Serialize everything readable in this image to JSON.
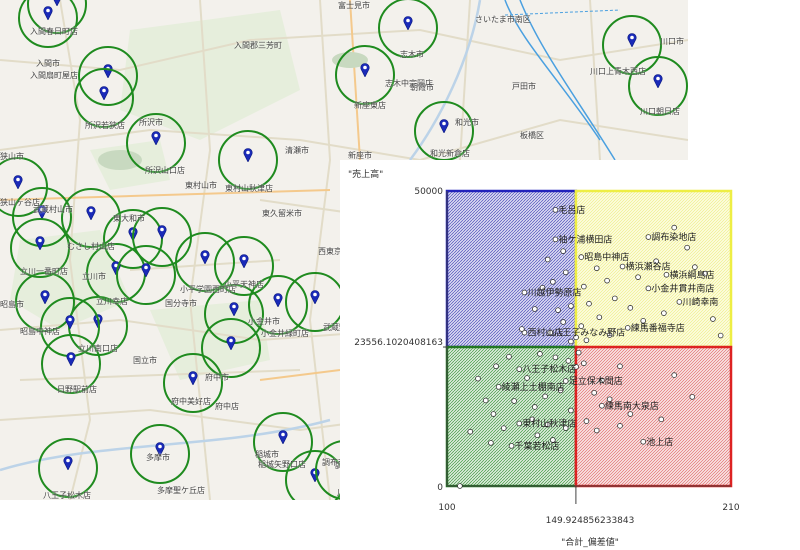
{
  "map": {
    "cities": [
      {
        "name": "入間春日町店"
      },
      {
        "name": "入間市"
      },
      {
        "name": "入間扇町屋店"
      },
      {
        "name": "入間郡三芳町"
      },
      {
        "name": "富士見市"
      },
      {
        "name": "さいたま市南区"
      },
      {
        "name": "志木市"
      },
      {
        "name": "志木中宗岡店"
      },
      {
        "name": "新座東店"
      },
      {
        "name": "朝霞市"
      },
      {
        "name": "戸田市"
      },
      {
        "name": "和光市"
      },
      {
        "name": "和光新倉店"
      },
      {
        "name": "板橋区"
      },
      {
        "name": "川口市"
      },
      {
        "name": "川口上青木西店"
      },
      {
        "name": "川口朝日店"
      },
      {
        "name": "所沢若狭店"
      },
      {
        "name": "所沢市"
      },
      {
        "name": "所沢山口店"
      },
      {
        "name": "清瀬市"
      },
      {
        "name": "新座市"
      },
      {
        "name": "東村山秋津店"
      },
      {
        "name": "東村山市"
      },
      {
        "name": "東久留米市"
      },
      {
        "name": "西東京市"
      },
      {
        "name": "狭山市"
      },
      {
        "name": "武蔵村山市"
      },
      {
        "name": "東大和市"
      },
      {
        "name": "むさし村山店"
      },
      {
        "name": "立川一番町店"
      },
      {
        "name": "立川市"
      },
      {
        "name": "立川幸店"
      },
      {
        "name": "昭島市"
      },
      {
        "name": "昭島中神店"
      },
      {
        "name": "立川南口店"
      },
      {
        "name": "小平学園西町店"
      },
      {
        "name": "小平天神店"
      },
      {
        "name": "国分寺市"
      },
      {
        "name": "小金井市"
      },
      {
        "name": "小金井緑町店"
      },
      {
        "name": "武蔵野"
      },
      {
        "name": "国立市"
      },
      {
        "name": "府中市"
      },
      {
        "name": "府中店"
      },
      {
        "name": "府中美好店"
      },
      {
        "name": "日野駅前店"
      },
      {
        "name": "多摩市"
      },
      {
        "name": "多摩聖ケ丘店"
      },
      {
        "name": "稲城市"
      },
      {
        "name": "稲城矢野口店"
      },
      {
        "name": "調布市"
      },
      {
        "name": "調布染"
      },
      {
        "name": "川崎市多"
      },
      {
        "name": "八王子松木店"
      },
      {
        "name": "狭山ヶ谷店"
      }
    ]
  },
  "chart_data": {
    "type": "scatter",
    "ylabel": "\"売上高\"",
    "xlabel": "\"合計_偏差値\"",
    "xlim": [
      100,
      210
    ],
    "ylim": [
      0,
      50000
    ],
    "x_ticks": [
      "100",
      "210"
    ],
    "y_ticks": [
      "0",
      "50000"
    ],
    "x_divider": 149.924856233843,
    "y_divider": 23556.1020408163,
    "x_divider_label": "149.924856233843",
    "y_divider_label": "23556.1020408163",
    "quadrant_colors": {
      "top_left": "#2222bb",
      "top_right": "#eeee44",
      "bottom_left": "#227722",
      "bottom_right": "#dd2222"
    },
    "points": [
      {
        "x": 142,
        "y": 46800,
        "label": "毛呂店"
      },
      {
        "x": 142,
        "y": 41800,
        "label": "袖ケ浦横田店"
      },
      {
        "x": 152,
        "y": 38800,
        "label": "昭島中神店"
      },
      {
        "x": 178,
        "y": 42200,
        "label": "調布染地店"
      },
      {
        "x": 168,
        "y": 37200,
        "label": "横浜瀬谷店"
      },
      {
        "x": 185,
        "y": 35800,
        "label": "横浜綱島店"
      },
      {
        "x": 178,
        "y": 33500,
        "label": "小金井貫井南店"
      },
      {
        "x": 190,
        "y": 31200,
        "label": "川崎幸南"
      },
      {
        "x": 130,
        "y": 32800,
        "label": "川越伊勢原店"
      },
      {
        "x": 130,
        "y": 26000,
        "label": "西村山店"
      },
      {
        "x": 140,
        "y": 26000,
        "label": "八王子みなみ野店"
      },
      {
        "x": 170,
        "y": 26800,
        "label": "練馬番福寺店"
      },
      {
        "x": 128,
        "y": 19800,
        "label": "八王子松木店"
      },
      {
        "x": 146,
        "y": 17800,
        "label": "足立保木間店"
      },
      {
        "x": 120,
        "y": 16800,
        "label": "綾瀬上土棚南店"
      },
      {
        "x": 160,
        "y": 13600,
        "label": "練馬南大泉店"
      },
      {
        "x": 128,
        "y": 10600,
        "label": "東村山秋津店"
      },
      {
        "x": 125,
        "y": 6800,
        "label": "千葉若松店"
      },
      {
        "x": 176,
        "y": 7500,
        "label": "池上店"
      },
      {
        "x": 112,
        "y": 18200
      },
      {
        "x": 115,
        "y": 14500
      },
      {
        "x": 118,
        "y": 12200
      },
      {
        "x": 109,
        "y": 9200
      },
      {
        "x": 122,
        "y": 9800
      },
      {
        "x": 134,
        "y": 13400
      },
      {
        "x": 138,
        "y": 15200
      },
      {
        "x": 142,
        "y": 21800
      },
      {
        "x": 147,
        "y": 21200
      },
      {
        "x": 150,
        "y": 20200
      },
      {
        "x": 136,
        "y": 22400
      },
      {
        "x": 124,
        "y": 21900
      },
      {
        "x": 119,
        "y": 20300
      },
      {
        "x": 131,
        "y": 18300
      },
      {
        "x": 144,
        "y": 16200
      },
      {
        "x": 148,
        "y": 12800
      },
      {
        "x": 146,
        "y": 9800
      },
      {
        "x": 141,
        "y": 7800
      },
      {
        "x": 135,
        "y": 8600
      },
      {
        "x": 117,
        "y": 7300
      },
      {
        "x": 105,
        "y": 0
      },
      {
        "x": 126,
        "y": 14400
      },
      {
        "x": 133,
        "y": 11300
      },
      {
        "x": 139,
        "y": 10400
      },
      {
        "x": 151,
        "y": 22600
      },
      {
        "x": 148,
        "y": 24500
      },
      {
        "x": 150,
        "y": 25200
      },
      {
        "x": 152,
        "y": 27100
      },
      {
        "x": 145,
        "y": 27800
      },
      {
        "x": 143,
        "y": 29800
      },
      {
        "x": 148,
        "y": 30500
      },
      {
        "x": 141,
        "y": 34600
      },
      {
        "x": 146,
        "y": 36200
      },
      {
        "x": 139,
        "y": 38400
      },
      {
        "x": 145,
        "y": 39800
      },
      {
        "x": 153,
        "y": 33800
      },
      {
        "x": 155,
        "y": 30900
      },
      {
        "x": 158,
        "y": 36900
      },
      {
        "x": 162,
        "y": 34800
      },
      {
        "x": 165,
        "y": 31800
      },
      {
        "x": 171,
        "y": 30200
      },
      {
        "x": 174,
        "y": 35400
      },
      {
        "x": 181,
        "y": 38100
      },
      {
        "x": 188,
        "y": 43800
      },
      {
        "x": 193,
        "y": 40400
      },
      {
        "x": 196,
        "y": 37100
      },
      {
        "x": 200,
        "y": 36000
      },
      {
        "x": 184,
        "y": 29300
      },
      {
        "x": 176,
        "y": 28000
      },
      {
        "x": 159,
        "y": 28600
      },
      {
        "x": 163,
        "y": 25600
      },
      {
        "x": 154,
        "y": 24700
      },
      {
        "x": 203,
        "y": 28300
      },
      {
        "x": 206,
        "y": 25500
      },
      {
        "x": 167,
        "y": 20300
      },
      {
        "x": 160,
        "y": 17900
      },
      {
        "x": 157,
        "y": 15800
      },
      {
        "x": 163,
        "y": 14700
      },
      {
        "x": 171,
        "y": 12200
      },
      {
        "x": 183,
        "y": 11300
      },
      {
        "x": 188,
        "y": 18800
      },
      {
        "x": 195,
        "y": 15100
      },
      {
        "x": 154,
        "y": 11000
      },
      {
        "x": 158,
        "y": 9400
      },
      {
        "x": 167,
        "y": 10200
      },
      {
        "x": 153,
        "y": 20800
      },
      {
        "x": 129,
        "y": 26600
      },
      {
        "x": 134,
        "y": 30000
      },
      {
        "x": 137,
        "y": 33600
      }
    ]
  }
}
